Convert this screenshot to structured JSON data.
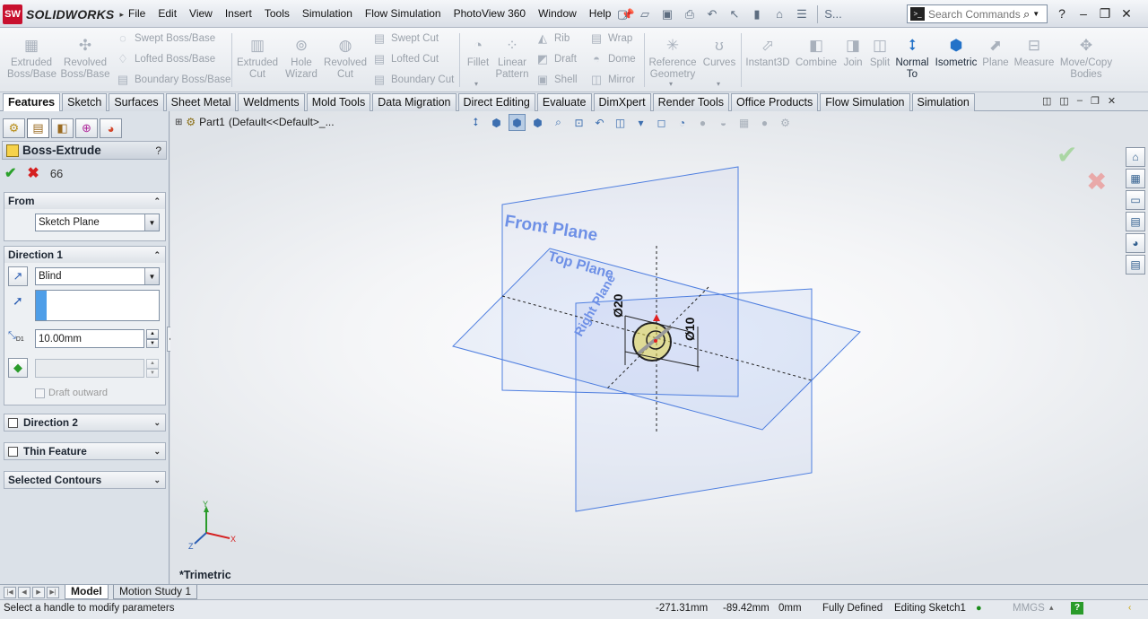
{
  "app": {
    "logo_mark": "SW",
    "logo_text": "SOLIDWORKS"
  },
  "menu": [
    "File",
    "Edit",
    "View",
    "Insert",
    "Tools",
    "Simulation",
    "Flow Simulation",
    "PhotoView 360",
    "Window",
    "Help"
  ],
  "quick_ellipsis": "S...",
  "search": {
    "placeholder": "Search Commands"
  },
  "features_toolbar": {
    "extruded_boss": "Extruded Boss/Base",
    "revolved_boss": "Revolved Boss/Base",
    "swept_boss": "Swept Boss/Base",
    "lofted_boss": "Lofted Boss/Base",
    "boundary_boss": "Boundary Boss/Base",
    "extruded_cut": "Extruded Cut",
    "hole_wizard": "Hole Wizard",
    "revolved_cut": "Revolved Cut",
    "swept_cut": "Swept Cut",
    "lofted_cut": "Lofted Cut",
    "boundary_cut": "Boundary Cut",
    "fillet": "Fillet",
    "linear_pattern": "Linear Pattern",
    "rib": "Rib",
    "draft": "Draft",
    "shell": "Shell",
    "wrap": "Wrap",
    "dome": "Dome",
    "mirror": "Mirror",
    "reference_geometry": "Reference Geometry",
    "curves": "Curves",
    "instant3d": "Instant3D",
    "combine": "Combine",
    "join": "Join",
    "split": "Split",
    "normal_to": "Normal To",
    "isometric": "Isometric",
    "plane": "Plane",
    "measure": "Measure",
    "move_copy": "Move/Copy Bodies"
  },
  "tabs": [
    "Features",
    "Sketch",
    "Surfaces",
    "Sheet Metal",
    "Weldments",
    "Mold Tools",
    "Data Migration",
    "Direct Editing",
    "Evaluate",
    "DimXpert",
    "Render Tools",
    "Office Products",
    "Flow Simulation",
    "Simulation"
  ],
  "active_tab": "Features",
  "property_manager": {
    "title": "Boss-Extrude",
    "help": "?",
    "from_title": "From",
    "from_value": "Sketch Plane",
    "direction1_title": "Direction 1",
    "end_condition": "Blind",
    "depth": "10.00mm",
    "depth_symbol": "D1",
    "draft_outward": "Draft outward",
    "direction2_title": "Direction 2",
    "thin_feature_title": "Thin Feature",
    "selected_contours_title": "Selected Contours"
  },
  "viewport": {
    "tree_part": "Part1",
    "tree_config": "(Default<<Default>_...",
    "front_plane": "Front Plane",
    "top_plane": "Top Plane",
    "right_plane": "Right Plane",
    "dim_outer": "Ø20",
    "dim_inner": "Ø10",
    "triad_y": "Y",
    "triad_x": "X",
    "triad_z": "Z",
    "view_name": "*Trimetric"
  },
  "bottom_tabs": [
    "Model",
    "Motion Study 1"
  ],
  "status": {
    "message": "Select a handle to modify parameters",
    "x": "-271.31mm",
    "y": "-89.42mm",
    "z": "0mm",
    "state": "Fully Defined",
    "editing": "Editing Sketch1",
    "units": "MMGS"
  },
  "colors": {
    "plane": "#4f7fe0",
    "accent": "#2372c8",
    "ok": "#2aa12a",
    "cancel": "#d52020"
  }
}
